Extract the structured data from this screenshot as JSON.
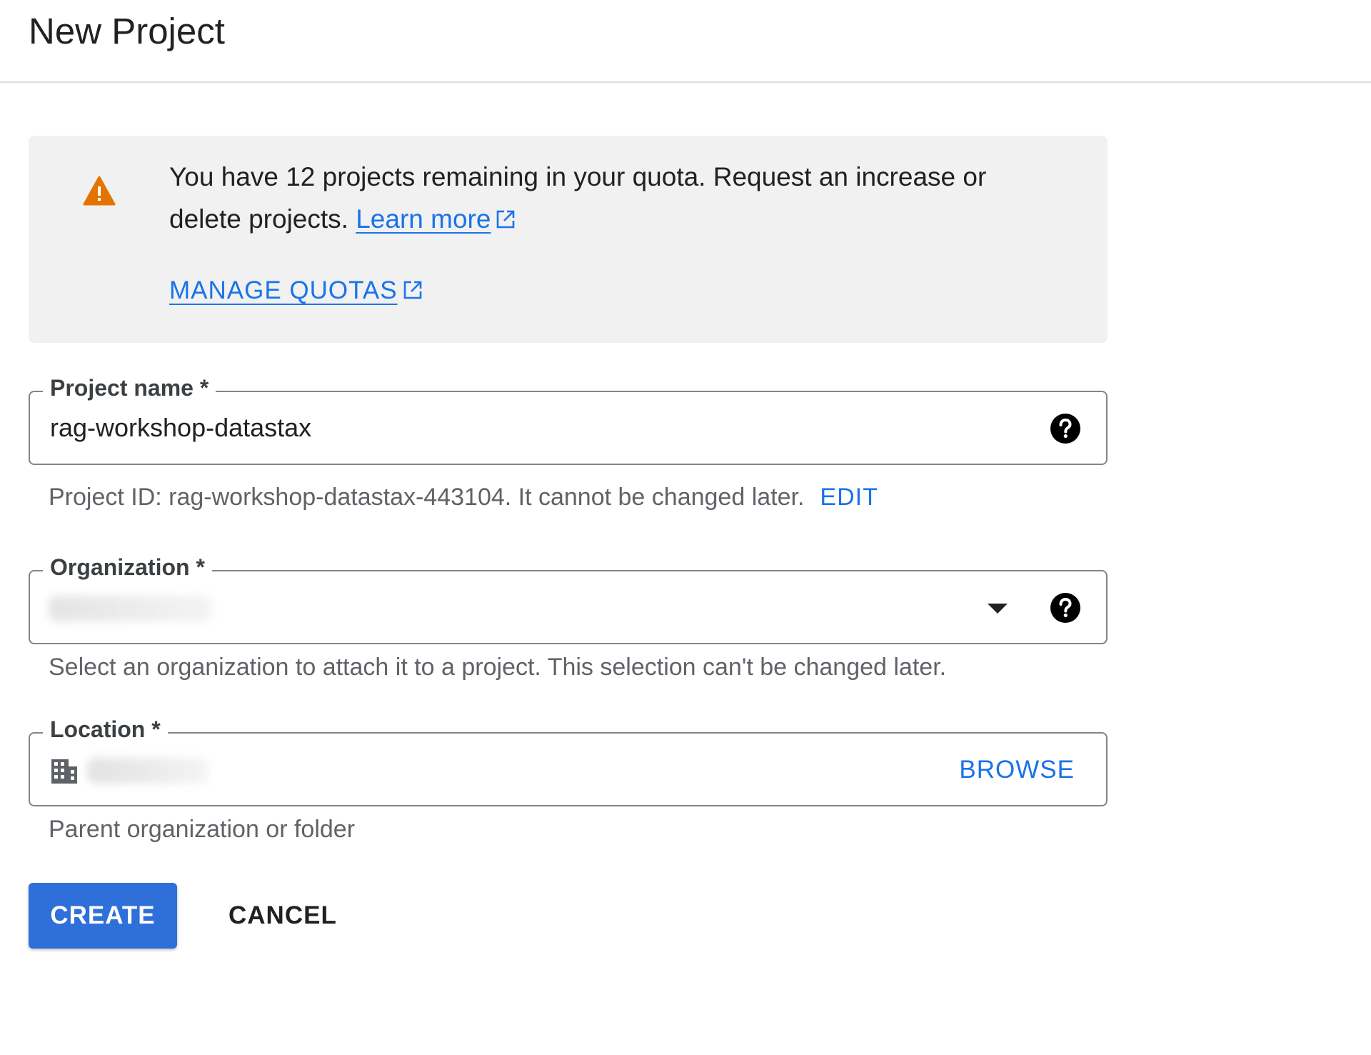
{
  "header": {
    "title": "New Project"
  },
  "quota_banner": {
    "icon": "warning-icon",
    "message": "You have 12 projects remaining in your quota. Request an increase or delete projects.",
    "learn_more_label": "Learn more",
    "manage_quotas_label": "MANAGE QUOTAS"
  },
  "project_name": {
    "label": "Project name *",
    "value": "rag-workshop-datastax",
    "help_icon": "help-icon"
  },
  "project_id": {
    "text": "Project ID: rag-workshop-datastax-443104. It cannot be changed later.",
    "edit_label": "EDIT"
  },
  "organization": {
    "label": "Organization *",
    "hint": "Select an organization to attach it to a project. This selection can't be changed later."
  },
  "location": {
    "label": "Location *",
    "browse_label": "BROWSE",
    "hint": "Parent organization or folder"
  },
  "actions": {
    "create_label": "CREATE",
    "cancel_label": "CANCEL"
  },
  "colors": {
    "accent": "#1a73e8",
    "primary_button": "#2f6fd9",
    "warning": "#e37400",
    "banner_bg": "#f1f1f1"
  }
}
